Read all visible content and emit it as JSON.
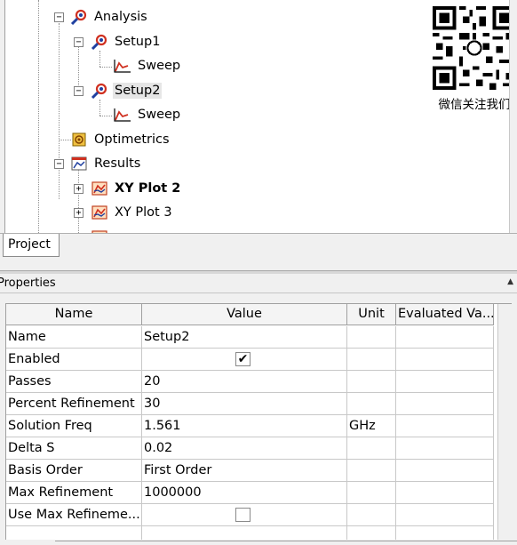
{
  "tree": {
    "items": [
      {
        "label": "Analysis",
        "icon": "analysis-icon"
      },
      {
        "label": "Setup1",
        "icon": "setup-icon"
      },
      {
        "label": "Sweep",
        "icon": "sweep-icon"
      },
      {
        "label": "Setup2",
        "icon": "setup-icon"
      },
      {
        "label": "Sweep",
        "icon": "sweep-icon"
      },
      {
        "label": "Optimetrics",
        "icon": "optimetrics-icon"
      },
      {
        "label": "Results",
        "icon": "results-icon"
      },
      {
        "label": "XY Plot 2",
        "icon": "xy-plot-icon"
      },
      {
        "label": "XY Plot 3",
        "icon": "xy-plot-icon"
      }
    ],
    "expander_minus": "−",
    "expander_plus": "+"
  },
  "qr": {
    "caption": "微信关注我们"
  },
  "tabs": {
    "project": "Project"
  },
  "properties": {
    "title": "Properties",
    "collapse_arrow": "▲",
    "columns": [
      "Name",
      "Value",
      "Unit",
      "Evaluated Va..."
    ],
    "rows": [
      {
        "name": "Name",
        "value": "Setup2",
        "unit": ""
      },
      {
        "name": "Enabled",
        "value": "",
        "unit": "",
        "checked": true
      },
      {
        "name": "Passes",
        "value": "20",
        "unit": ""
      },
      {
        "name": "Percent Refinement",
        "value": "30",
        "unit": ""
      },
      {
        "name": "Solution Freq",
        "value": "1.561",
        "unit": "GHz"
      },
      {
        "name": "Delta S",
        "value": "0.02",
        "unit": ""
      },
      {
        "name": "Basis Order",
        "value": "First Order",
        "unit": ""
      },
      {
        "name": "Max Refinement",
        "value": "1000000",
        "unit": ""
      },
      {
        "name": "Use Max Refineme...",
        "value": "",
        "unit": "",
        "checked": false
      }
    ],
    "check_mark": "✔"
  },
  "colors": {
    "selection": "#e6e6e6",
    "icon_red": "#d03020",
    "icon_blue": "#2040a0"
  }
}
